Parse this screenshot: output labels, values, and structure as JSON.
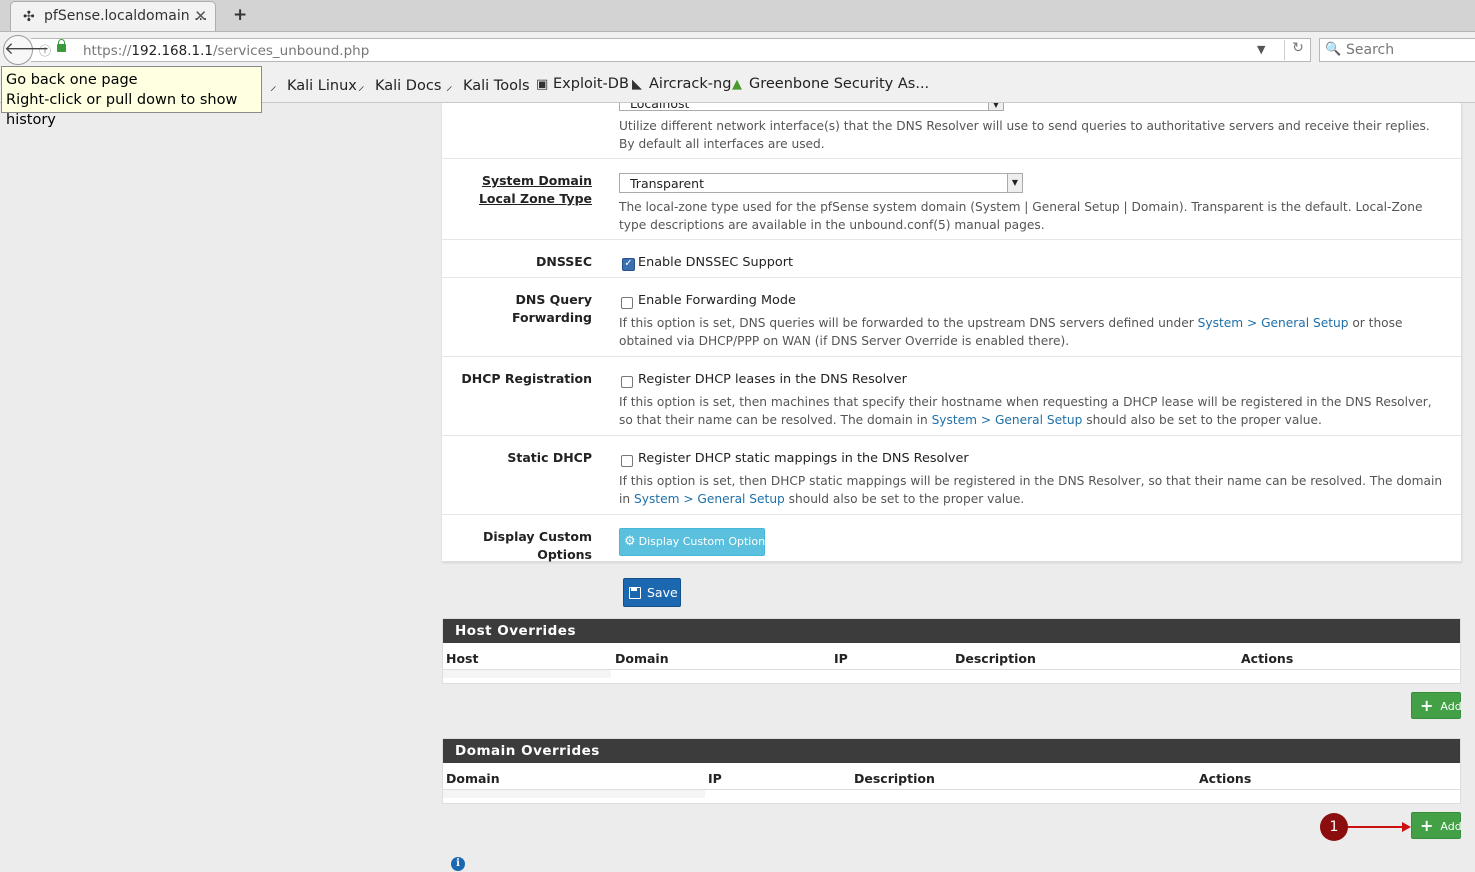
{
  "browser": {
    "tab_title": "pfSense.localdomain ...",
    "url_prefix": "https://",
    "url_host": "192.168.1.1",
    "url_path": "/services_unbound.php",
    "search_placeholder": "Search",
    "tooltip_line1": "Go back one page",
    "tooltip_line2": "Right-click or pull down to show history",
    "bookmarks": [
      "Kali Linux",
      "Kali Docs",
      "Kali Tools",
      "Exploit-DB",
      "Aircrack-ng",
      "Greenbone Security As..."
    ]
  },
  "form": {
    "outgoing_select_partial": "Localhost",
    "outgoing_help": "Utilize different network interface(s) that the DNS Resolver will use to send queries to authoritative servers and receive their replies. By default all interfaces are used.",
    "zone_label": "System Domain Local Zone Type",
    "zone_value": "Transparent",
    "zone_help": "The local-zone type used for the pfSense system domain (System | General Setup | Domain). Transparent is the default. Local-Zone type descriptions are available in the unbound.conf(5) manual pages.",
    "dnssec_label": "DNSSEC",
    "dnssec_checkbox": "Enable DNSSEC Support",
    "dnssec_checked": true,
    "fwd_label": "DNS Query Forwarding",
    "fwd_checkbox": "Enable Forwarding Mode",
    "fwd_help_a": "If this option is set, DNS queries will be forwarded to the upstream DNS servers defined under ",
    "fwd_help_link": "System > General Setup",
    "fwd_help_b": " or those obtained via DHCP/PPP on WAN (if DNS Server Override is enabled there).",
    "dhcp_label": "DHCP Registration",
    "dhcp_checkbox": "Register DHCP leases in the DNS Resolver",
    "dhcp_help_a": "If this option is set, then machines that specify their hostname when requesting a DHCP lease will be registered in the DNS Resolver, so that their name can be resolved. The domain in ",
    "dhcp_help_link": "System > General Setup",
    "dhcp_help_b": " should also be set to the proper value.",
    "static_label": "Static DHCP",
    "static_checkbox": "Register DHCP static mappings in the DNS Resolver",
    "static_help_a": "If this option is set, then DHCP static mappings will be registered in the DNS Resolver, so that their name can be resolved. The domain in ",
    "static_help_link": "System > General Setup",
    "static_help_b": " should also be set to the proper value.",
    "custom_label": "Display Custom Options",
    "custom_button": "Display Custom Options",
    "save_button": "Save"
  },
  "host_overrides": {
    "title": "Host Overrides",
    "columns": [
      "Host",
      "Domain",
      "IP",
      "Description",
      "Actions"
    ],
    "add_button": "Add"
  },
  "domain_overrides": {
    "title": "Domain Overrides",
    "columns": [
      "Domain",
      "IP",
      "Description",
      "Actions"
    ],
    "add_button": "Add"
  },
  "annotation": {
    "marker_number": "1",
    "marker_color": "#8b0d0d",
    "arrow_color": "#cc1111"
  },
  "colors": {
    "link": "#1f6fa8",
    "save": "#1c68b0",
    "add": "#43a047",
    "info_button": "#5bc0de",
    "section_header": "#3c3c3c"
  }
}
